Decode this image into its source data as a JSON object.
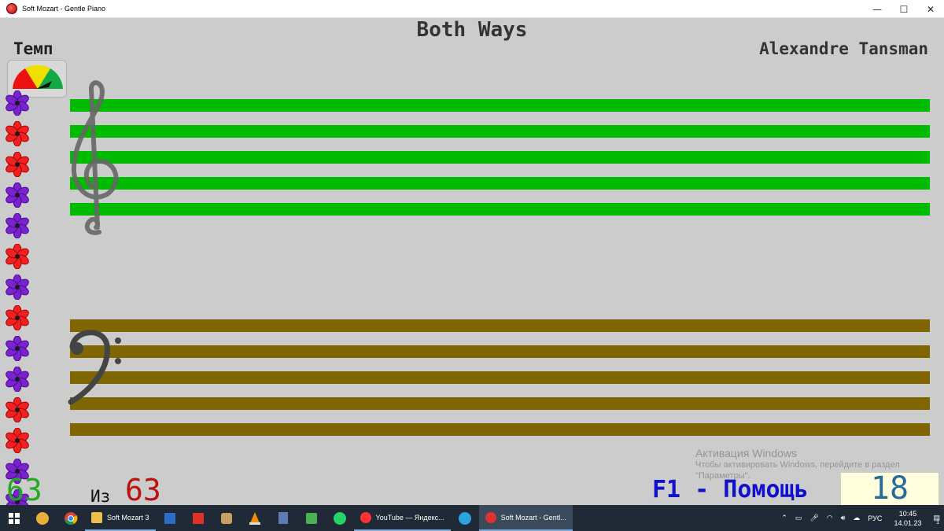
{
  "window": {
    "title": "Soft Mozart - Gentle Piano",
    "minimize": "—",
    "maximize": "☐",
    "close": "✕"
  },
  "song": {
    "title": "Both Ways",
    "composer": "Alexandre Tansman"
  },
  "tempo": {
    "label": "Темп"
  },
  "progress": {
    "done": "63",
    "of_label": "Из",
    "total": "63"
  },
  "help_hint": "F1 - Помощь",
  "score": "18",
  "activation": {
    "title": "Активация Windows",
    "subtitle": "Чтобы активировать Windows, перейдите в раздел \"Параметры\"."
  },
  "flowers": [
    "purple",
    "red",
    "red",
    "purple",
    "purple",
    "red",
    "purple",
    "red",
    "purple",
    "purple",
    "red",
    "red",
    "purple",
    "purple"
  ],
  "colors": {
    "treble_staff": "#00bb00",
    "bass_staff": "#806600",
    "count_done": "#22aa22",
    "count_total": "#bb1111",
    "help": "#1111cc"
  },
  "taskbar": {
    "apps": [
      {
        "label": "Soft Mozart 3"
      },
      {
        "label": "YouTube — Яндекс..."
      },
      {
        "label": "Soft Mozart - Gentl..."
      }
    ],
    "lang": "РУС",
    "time": "10:45",
    "date": "14.01.23",
    "notifications": "1"
  }
}
